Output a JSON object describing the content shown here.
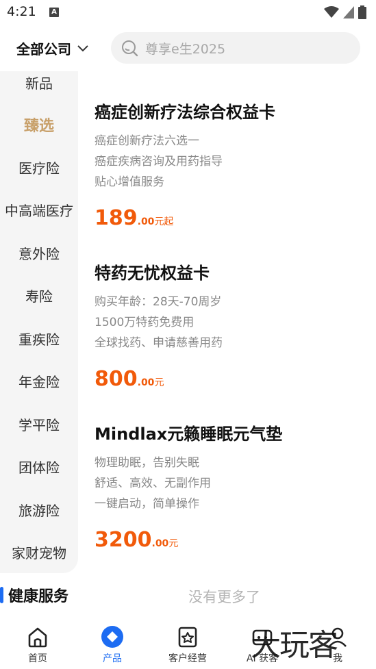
{
  "status_bar": {
    "time": "4:21",
    "a_badge": "A"
  },
  "header": {
    "company_select": "全部公司",
    "search_placeholder": "尊享e生2025"
  },
  "sidebar": {
    "items": [
      {
        "label": "新品",
        "active": false
      },
      {
        "label": "臻选",
        "active": true
      },
      {
        "label": "医疗险",
        "active": false
      },
      {
        "label": "中高端医疗",
        "active": false
      },
      {
        "label": "意外险",
        "active": false
      },
      {
        "label": "寿险",
        "active": false
      },
      {
        "label": "重疾险",
        "active": false
      },
      {
        "label": "年金险",
        "active": false
      },
      {
        "label": "学平险",
        "active": false
      },
      {
        "label": "团体险",
        "active": false
      },
      {
        "label": "旅游险",
        "active": false
      },
      {
        "label": "家财宠物",
        "active": false
      }
    ],
    "section_title": "健康服务"
  },
  "products": [
    {
      "name": "癌症创新疗法综合权益卡",
      "desc": [
        "癌症创新疗法六选一",
        "癌症疾病咨询及用药指导",
        "贴心增值服务"
      ],
      "price_int": "189",
      "price_dec": ".00",
      "price_unit": "元起"
    },
    {
      "name": "特药无忧权益卡",
      "desc": [
        "购买年龄：28天-70周岁",
        "1500万特药免费用",
        "全球找药、申请慈善用药"
      ],
      "price_int": "800",
      "price_dec": ".00",
      "price_unit": "元"
    },
    {
      "name": "Mindlax元籁睡眠元气垫",
      "desc": [
        "物理助眠，告别失眠",
        "舒适、高效、无副作用",
        "一键启动，简单操作"
      ],
      "price_int": "3200",
      "price_dec": ".00",
      "price_unit": "元"
    }
  ],
  "no_more": "没有更多了",
  "bottom_nav": [
    {
      "label": "首页",
      "icon": "home-icon",
      "active": false
    },
    {
      "label": "产品",
      "icon": "product-icon",
      "active": true
    },
    {
      "label": "客户经营",
      "icon": "customer-icon",
      "active": false
    },
    {
      "label": "AI 获客",
      "icon": "ai-icon",
      "active": false
    },
    {
      "label": "我",
      "icon": "me-icon",
      "active": false
    }
  ],
  "watermark": "大玩客",
  "colors": {
    "accent": "#1d6cf2",
    "price": "#f15a0a",
    "active_side": "#c8a06a"
  }
}
